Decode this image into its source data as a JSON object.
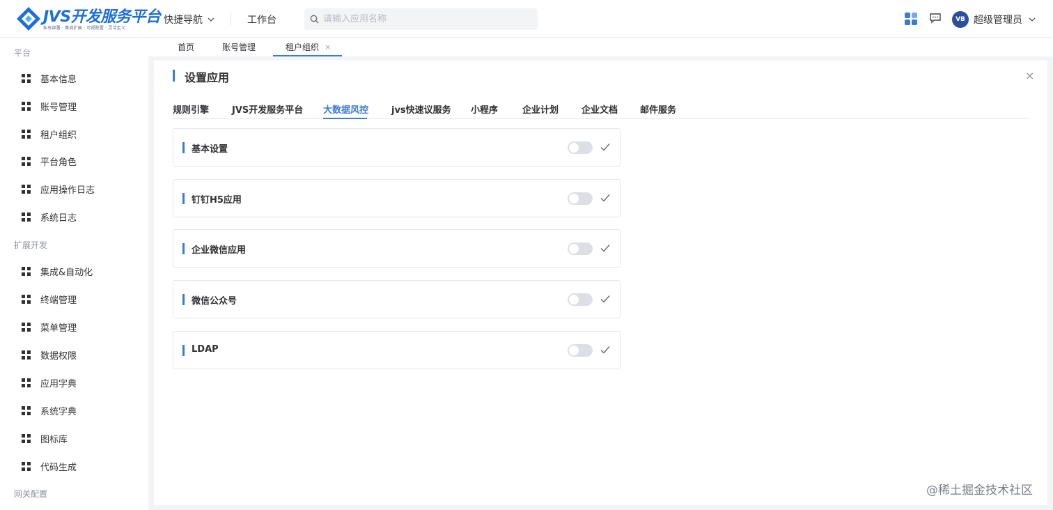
{
  "header": {
    "logo_title": "JVS开发服务平台",
    "logo_subtitle": "私有部署 · 集成扩展 · 可视配置 · 灵活定义",
    "quick_nav_label": "快捷导航",
    "workbench_label": "工作台",
    "search_placeholder": "请输入应用名称",
    "avatar_text": "VB",
    "user_name": "超级管理员"
  },
  "sidebar": {
    "group_platform": "平台",
    "platform_items": [
      {
        "label": "基本信息"
      },
      {
        "label": "账号管理"
      },
      {
        "label": "租户组织"
      },
      {
        "label": "平台角色"
      },
      {
        "label": "应用操作日志"
      },
      {
        "label": "系统日志"
      }
    ],
    "group_extend": "扩展开发",
    "extend_items": [
      {
        "label": "集成&自动化"
      },
      {
        "label": "终端管理"
      },
      {
        "label": "菜单管理"
      },
      {
        "label": "数据权限"
      },
      {
        "label": "应用字典"
      },
      {
        "label": "系统字典"
      },
      {
        "label": "图标库"
      },
      {
        "label": "代码生成"
      }
    ],
    "group_gateway": "网关配置"
  },
  "tabs": [
    {
      "label": "首页"
    },
    {
      "label": "账号管理"
    },
    {
      "label": "租户组织",
      "active": true,
      "close": "×"
    }
  ],
  "panel": {
    "title": "设置应用",
    "close": "×",
    "app_tabs": [
      {
        "label": "规则引擎"
      },
      {
        "label": "JVS开发服务平台"
      },
      {
        "label": "大数据风控",
        "active": true
      },
      {
        "label": "jvs快速议服务"
      },
      {
        "label": "小程序"
      },
      {
        "label": "企业计划"
      },
      {
        "label": "企业文档"
      },
      {
        "label": "邮件服务"
      }
    ],
    "settings": [
      {
        "label": "基本设置",
        "enabled": false
      },
      {
        "label": "钉钉H5应用",
        "enabled": false
      },
      {
        "label": "企业微信应用",
        "enabled": false
      },
      {
        "label": "微信公众号",
        "enabled": false
      },
      {
        "label": "LDAP",
        "enabled": false
      }
    ]
  },
  "watermark": "@稀土掘金技术社区",
  "colors": {
    "accent": "#3a7bd5",
    "brand": "#1e6fd6",
    "toggle_off": "#dcdfe6"
  }
}
